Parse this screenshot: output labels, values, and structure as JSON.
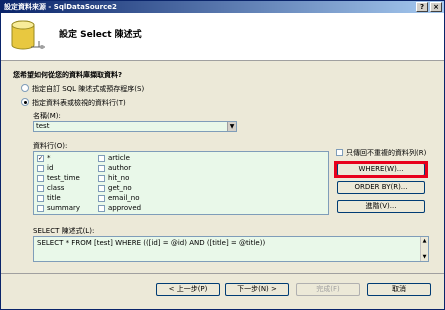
{
  "window": {
    "title": "設定資料來源 - SqlDataSource2",
    "help_btn": "?",
    "close_btn": "×"
  },
  "header": {
    "title": "設定 Select 陳述式"
  },
  "question": "您希望如何從您的資料庫擷取資料?",
  "options": {
    "custom_sql": "指定自訂 SQL 陳述式或預存程序(S)",
    "table_columns": "指定資料表或檢視的資料行(T)"
  },
  "name_label": "名稱(M):",
  "table_name": "test",
  "columns_label": "資料行(O):",
  "columns": [
    {
      "name": "*",
      "checked": true
    },
    {
      "name": "id",
      "checked": false
    },
    {
      "name": "test_time",
      "checked": false
    },
    {
      "name": "class",
      "checked": false
    },
    {
      "name": "title",
      "checked": false
    },
    {
      "name": "summary",
      "checked": false
    },
    {
      "name": "article",
      "checked": false
    },
    {
      "name": "author",
      "checked": false
    },
    {
      "name": "hit_no",
      "checked": false
    },
    {
      "name": "get_no",
      "checked": false
    },
    {
      "name": "email_no",
      "checked": false
    },
    {
      "name": "approved",
      "checked": false
    }
  ],
  "unique_rows_label": "只傳回不重複的資料列(R)",
  "buttons": {
    "where": "WHERE(W)...",
    "order_by": "ORDER BY(R)...",
    "advanced": "進階(V)..."
  },
  "select_label": "SELECT 陳述式(L):",
  "select_statement": "SELECT * FROM [test] WHERE (([id] = @id) AND ([title] = @title))",
  "footer": {
    "prev": "< 上一步(P)",
    "next": "下一步(N) >",
    "finish": "完成(F)",
    "cancel": "取消"
  }
}
